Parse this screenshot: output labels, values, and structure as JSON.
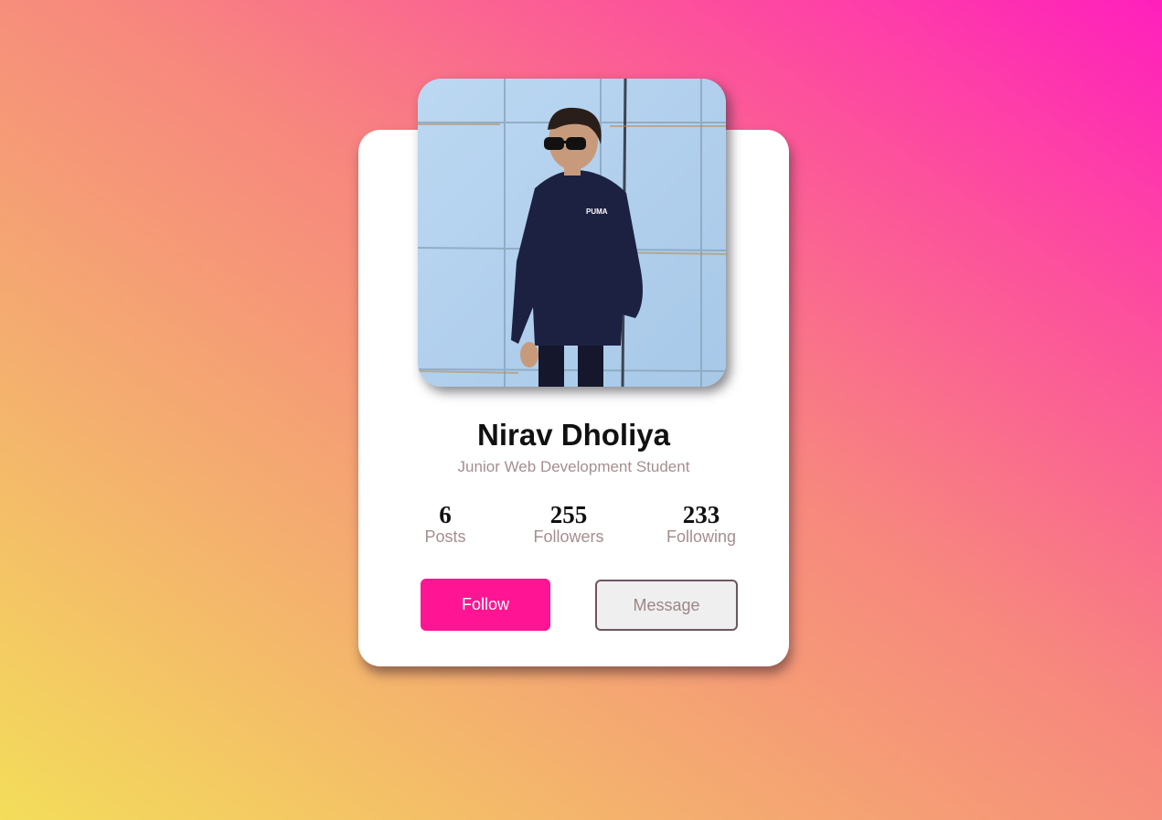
{
  "profile": {
    "name": "Nirav Dholiya",
    "role": "Junior Web Development Student",
    "photo": "profile-photo"
  },
  "stats": [
    {
      "value": "6",
      "label": "Posts"
    },
    {
      "value": "255",
      "label": "Followers"
    },
    {
      "value": "233",
      "label": "Following"
    }
  ],
  "actions": {
    "follow_label": "Follow",
    "message_label": "Message"
  },
  "colors": {
    "accent": "#ff1493",
    "muted_text": "#a58e8e",
    "card": "#ffffff"
  }
}
